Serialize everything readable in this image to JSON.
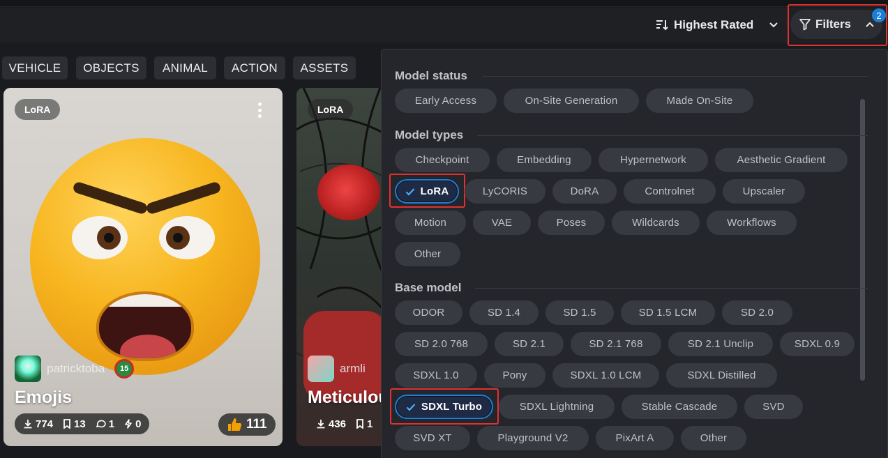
{
  "toolbar": {
    "sort_label": "Highest Rated",
    "filters_label": "Filters",
    "filters_badge": "2"
  },
  "categories": [
    "VEHICLE",
    "OBJECTS",
    "ANIMAL",
    "ACTION",
    "ASSETS"
  ],
  "cards": [
    {
      "type": "LoRA",
      "username": "patricktoba",
      "level": "15",
      "title": "Emojis",
      "downloads": "774",
      "bookmarks": "13",
      "comments": "1",
      "tips": "0",
      "likes": "111"
    },
    {
      "type": "LoRA",
      "username": "armli",
      "title": "Meticulou",
      "downloads": "436",
      "bookmarks": "1"
    }
  ],
  "filters": {
    "model_status": {
      "title": "Model status",
      "options": [
        "Early Access",
        "On-Site Generation",
        "Made On-Site"
      ]
    },
    "model_types": {
      "title": "Model types",
      "options": [
        "Checkpoint",
        "Embedding",
        "Hypernetwork",
        "Aesthetic Gradient",
        "LoRA",
        "LyCORIS",
        "DoRA",
        "Controlnet",
        "Upscaler",
        "Motion",
        "VAE",
        "Poses",
        "Wildcards",
        "Workflows",
        "Other"
      ],
      "selected": "LoRA"
    },
    "base_model": {
      "title": "Base model",
      "options": [
        "ODOR",
        "SD 1.4",
        "SD 1.5",
        "SD 1.5 LCM",
        "SD 2.0",
        "SD 2.0 768",
        "SD 2.1",
        "SD 2.1 768",
        "SD 2.1 Unclip",
        "SDXL 0.9",
        "SDXL 1.0",
        "Pony",
        "SDXL 1.0 LCM",
        "SDXL Distilled",
        "SDXL Turbo",
        "SDXL Lightning",
        "Stable Cascade",
        "SVD",
        "SVD XT",
        "Playground V2",
        "PixArt A",
        "Other"
      ],
      "selected": "SDXL Turbo"
    }
  },
  "colors": {
    "accent": "#1c7ed6",
    "highlight": "#e03131",
    "panel_bg": "#25262b",
    "chip_bg": "#373a40"
  }
}
